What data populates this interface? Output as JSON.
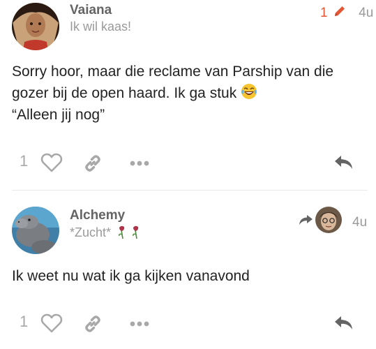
{
  "posts": [
    {
      "username": "Vaiana",
      "user_title": "Ik wil kaas!",
      "edit_count": "1",
      "age": "4u",
      "body_line1": "Sorry hoor, maar die reclame van Parship van die",
      "body_line2": "gozer bij de open haard. Ik ga stuk",
      "body_line3": "“Alleen jij nog”",
      "like_count": "1",
      "avatar_icon": "vaiana-avatar",
      "edit_icon": "pencil-icon"
    },
    {
      "username": "Alchemy",
      "user_title": "*Zucht*",
      "age": "4u",
      "body_line1": "Ik weet nu wat ik ga kijken vanavond",
      "like_count": "1",
      "avatar_icon": "hippo-avatar",
      "reply_icon": "reply-arrow-icon"
    }
  ],
  "colors": {
    "accent": "#e45735",
    "muted": "#9a9a9a",
    "icon": "#a8a8a8",
    "reply": "#646464"
  }
}
